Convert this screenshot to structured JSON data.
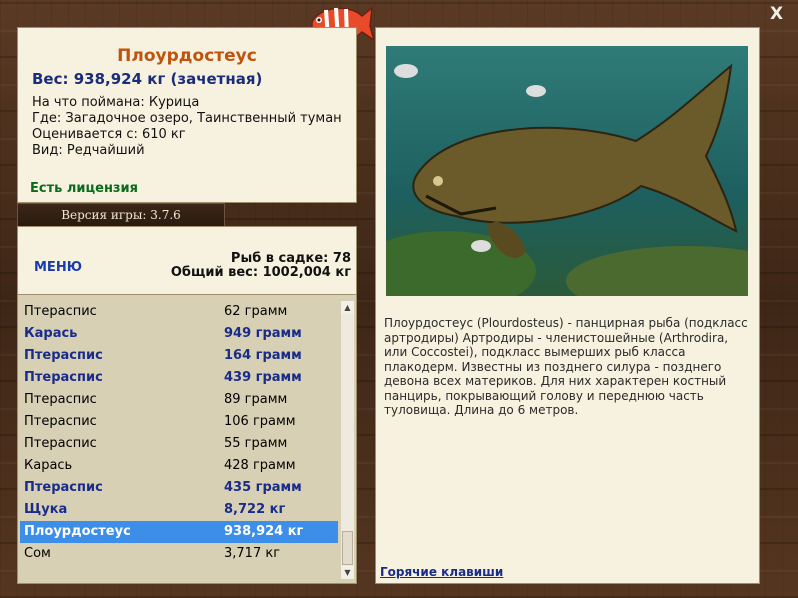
{
  "info": {
    "fish_name": "Плоурдостеус",
    "weight": "Вес: 938,924 кг (зачетная)",
    "bait": "На что поймана: Курица",
    "place": "Где: Загадочное озеро, Таинственный туман",
    "value": "Оценивается с: 610 кг",
    "kind": "Вид: Редчайший",
    "license": "Есть лицензия"
  },
  "version": "Версия игры: 3.7.6",
  "stats": {
    "menu_label": "МЕНЮ",
    "fish_count": "Рыб в садке: 78",
    "total_weight": "Общий вес: 1002,004 кг"
  },
  "catch_list": [
    {
      "name": "Птераспис",
      "weight": "62 грамм",
      "bold": false
    },
    {
      "name": "Карась",
      "weight": "949 грамм",
      "bold": true
    },
    {
      "name": "Птераспис",
      "weight": "164 грамм",
      "bold": true
    },
    {
      "name": "Птераспис",
      "weight": "439 грамм",
      "bold": true
    },
    {
      "name": "Птераспис",
      "weight": "89 грамм",
      "bold": false
    },
    {
      "name": "Птераспис",
      "weight": "106 грамм",
      "bold": false
    },
    {
      "name": "Птераспис",
      "weight": "55 грамм",
      "bold": false
    },
    {
      "name": "Карась",
      "weight": "428 грамм",
      "bold": false
    },
    {
      "name": "Птераспис",
      "weight": "435 грамм",
      "bold": true
    },
    {
      "name": "Щука",
      "weight": "8,722 кг",
      "bold": true
    },
    {
      "name": "Плоурдостеус",
      "weight": "938,924 кг",
      "bold": true,
      "selected": true
    },
    {
      "name": "Сом",
      "weight": "3,717 кг",
      "bold": false
    }
  ],
  "description": "Плоурдостеус (Plourdosteus) - панцирная рыба (подкласс артродиры) Артродиры - членистошейные (Arthrodira, или Coccostei), подкласс вымерших рыб класса плакодерм. Известны из позднего силура - позднего девона всех материков. Для них характерен костный панцирь, покрывающий голову и переднюю часть туловища. Длина до 6 метров.",
  "hotkeys_label": "Горячие клавиши",
  "close_label": "X",
  "colors": {
    "selected_row": "#3c8ee8",
    "fish_title": "#c0530e",
    "weight": "#1a2c7a",
    "license": "#0b6a1c"
  }
}
